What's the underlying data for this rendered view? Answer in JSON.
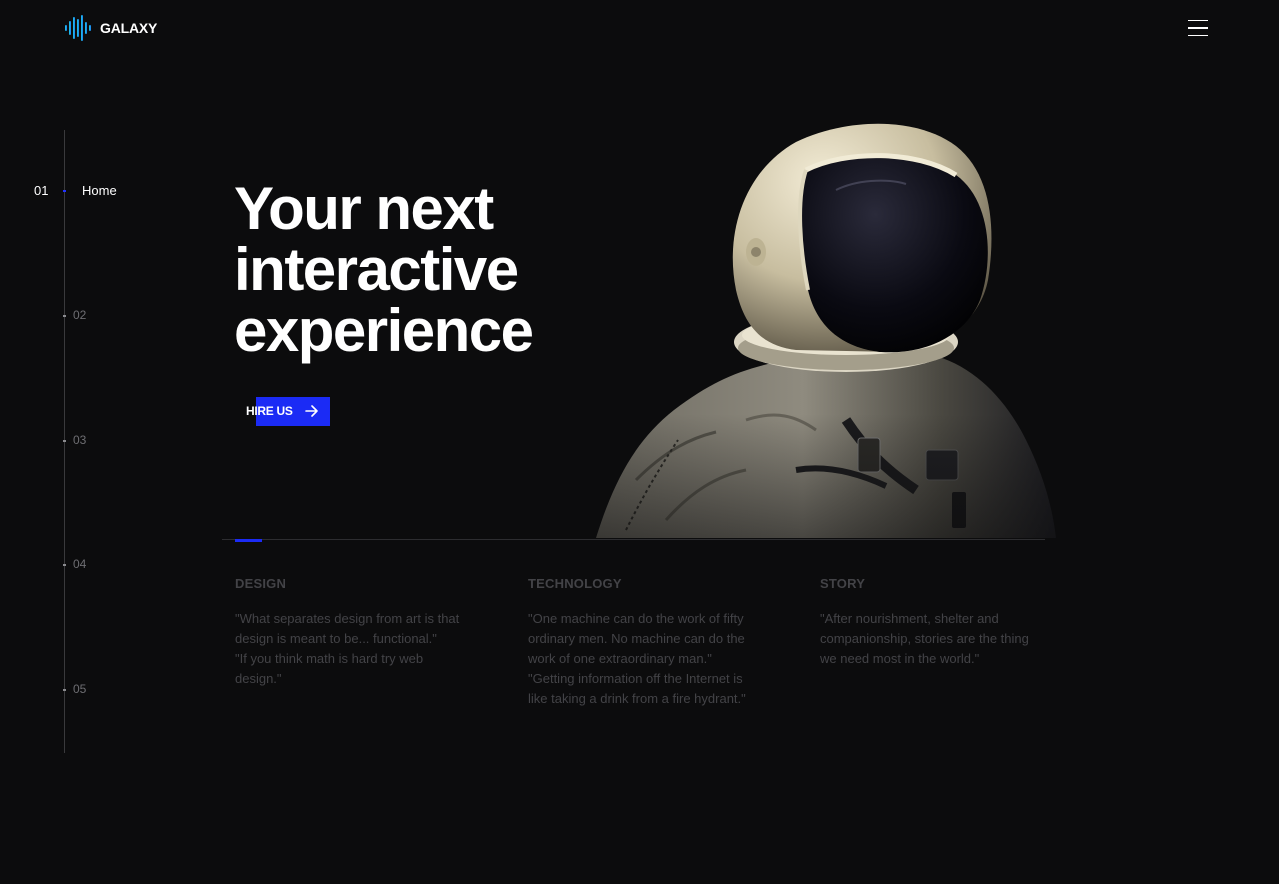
{
  "brand": {
    "name": "GALAXY",
    "logo_icon": "soundwave-logo-icon",
    "logo_colors": [
      "#1ec8e6",
      "#1b7df0"
    ]
  },
  "header": {
    "menu_icon": "hamburger-menu-icon"
  },
  "slide_nav": {
    "items": [
      {
        "number": "01",
        "label": "Home",
        "active": true
      },
      {
        "number": "02",
        "label": ""
      },
      {
        "number": "03",
        "label": ""
      },
      {
        "number": "04",
        "label": ""
      },
      {
        "number": "05",
        "label": ""
      }
    ]
  },
  "hero": {
    "title_lines": [
      "Your next",
      "interactive",
      "experience"
    ],
    "cta_label": "HIRE US",
    "cta_icon": "arrow-right-icon",
    "image_icon": "astronaut-image"
  },
  "features": [
    {
      "title": "DESIGN",
      "quotes": [
        "\"What separates design from art is that design is meant to be... functional.\"",
        "\"If you think math is hard try web design.\""
      ]
    },
    {
      "title": "TECHNOLOGY",
      "quotes": [
        "\"One machine can do the work of fifty ordinary men. No machine can do the work of one extraordinary man.\"",
        "\"Getting information off the Internet is like taking a drink from a fire hydrant.\""
      ]
    },
    {
      "title": "STORY",
      "quotes": [
        "\"After nourishment, shelter and companionship, stories are the thing we need most in the world.\""
      ]
    }
  ],
  "colors": {
    "background": "#0c0c0d",
    "accent": "#1b2bf5",
    "muted_text": "#434347",
    "rail": "#3a3a3c"
  }
}
